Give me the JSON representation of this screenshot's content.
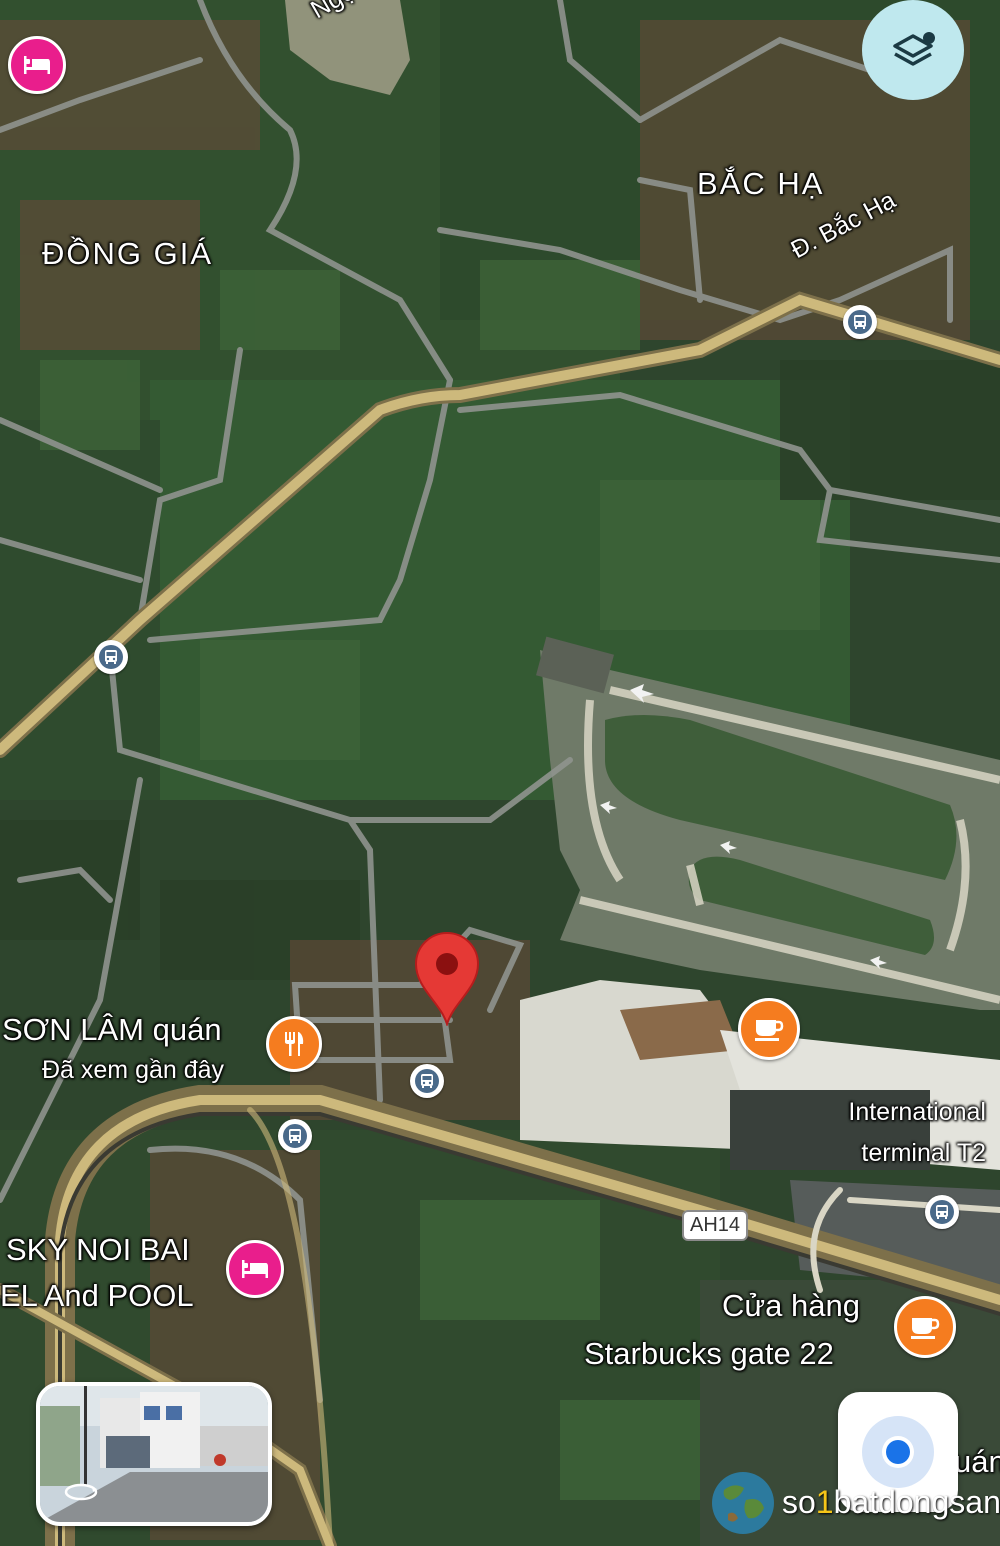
{
  "place_labels": {
    "dong_gia": "ĐỒNG GIÁ",
    "bac_ha": "BẮC HẠ",
    "road_bac_ha": "Đ. Bắc Hạ",
    "ngoc_partial": "Ngọ"
  },
  "pois": {
    "son_lam": {
      "name": "SƠN LÂM quán",
      "sub": "Đã xem gần đây",
      "icon": "restaurant-icon",
      "color": "#f57c1f"
    },
    "terminal": {
      "line1": "International",
      "line2": "terminal T2"
    },
    "starbucks": {
      "line1": "Cửa hàng",
      "line2": "Starbucks gate 22",
      "icon": "coffee-icon",
      "color": "#f57c1f"
    },
    "sky_noi_bai": {
      "line1": "SKY NOI BAI",
      "line2": "EL And POOL",
      "icon": "hotel-icon",
      "color": "#e91e8c"
    },
    "cafe_near_terminal": {
      "icon": "coffee-icon",
      "color": "#f57c1f"
    },
    "hotel_top_left": {
      "icon": "hotel-icon",
      "color": "#e91e8c"
    },
    "partial_right": "uán"
  },
  "road_shield": "AH14",
  "controls": {
    "layers_button": "layers-icon",
    "my_location_button": "my-location-icon",
    "street_view_thumbnail": "street-view-preview"
  },
  "watermark": {
    "prefix": "so",
    "digit": "1",
    "suffix": "batdongsan"
  },
  "colors": {
    "marker": "#e53935",
    "major_road": "#c8b478",
    "bus_stop": "#4a6a8a",
    "layers_bg": "#bfe8ee",
    "location_dot": "#1a73e8"
  }
}
